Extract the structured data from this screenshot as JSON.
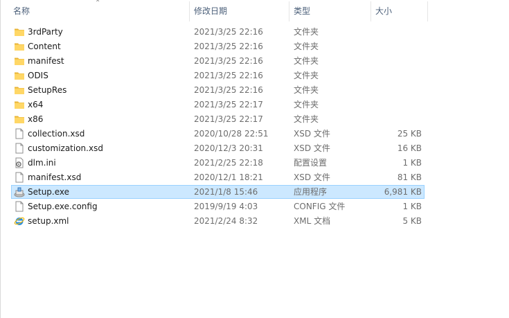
{
  "columns": {
    "name": "名称",
    "date": "修改日期",
    "type": "类型",
    "size": "大小",
    "sort_glyph": "⌃"
  },
  "files": [
    {
      "name": "3rdParty",
      "date": "2021/3/25 22:16",
      "type": "文件夹",
      "size": "",
      "icon": "folder-icon"
    },
    {
      "name": "Content",
      "date": "2021/3/25 22:16",
      "type": "文件夹",
      "size": "",
      "icon": "folder-icon"
    },
    {
      "name": "manifest",
      "date": "2021/3/25 22:16",
      "type": "文件夹",
      "size": "",
      "icon": "folder-icon"
    },
    {
      "name": "ODIS",
      "date": "2021/3/25 22:16",
      "type": "文件夹",
      "size": "",
      "icon": "folder-icon"
    },
    {
      "name": "SetupRes",
      "date": "2021/3/25 22:16",
      "type": "文件夹",
      "size": "",
      "icon": "folder-icon"
    },
    {
      "name": "x64",
      "date": "2021/3/25 22:17",
      "type": "文件夹",
      "size": "",
      "icon": "folder-icon"
    },
    {
      "name": "x86",
      "date": "2021/3/25 22:17",
      "type": "文件夹",
      "size": "",
      "icon": "folder-icon"
    },
    {
      "name": "collection.xsd",
      "date": "2020/10/28 22:51",
      "type": "XSD 文件",
      "size": "25 KB",
      "icon": "document-icon"
    },
    {
      "name": "customization.xsd",
      "date": "2020/12/3 20:31",
      "type": "XSD 文件",
      "size": "16 KB",
      "icon": "document-icon"
    },
    {
      "name": "dlm.ini",
      "date": "2021/2/25 22:18",
      "type": "配置设置",
      "size": "1 KB",
      "icon": "settings-file-icon"
    },
    {
      "name": "manifest.xsd",
      "date": "2020/12/1 18:21",
      "type": "XSD 文件",
      "size": "81 KB",
      "icon": "document-icon"
    },
    {
      "name": "Setup.exe",
      "date": "2021/1/8 15:46",
      "type": "应用程序",
      "size": "6,981 KB",
      "icon": "installer-icon",
      "selected": true
    },
    {
      "name": "Setup.exe.config",
      "date": "2019/9/19 4:03",
      "type": "CONFIG 文件",
      "size": "1 KB",
      "icon": "document-icon"
    },
    {
      "name": "setup.xml",
      "date": "2021/2/24 8:32",
      "type": "XML 文档",
      "size": "5 KB",
      "icon": "internet-explorer-icon"
    }
  ],
  "colors": {
    "selection": "#cce8ff",
    "selection_border": "#99d1ff",
    "folder": "#ffd766",
    "header_text": "#4c607a"
  }
}
